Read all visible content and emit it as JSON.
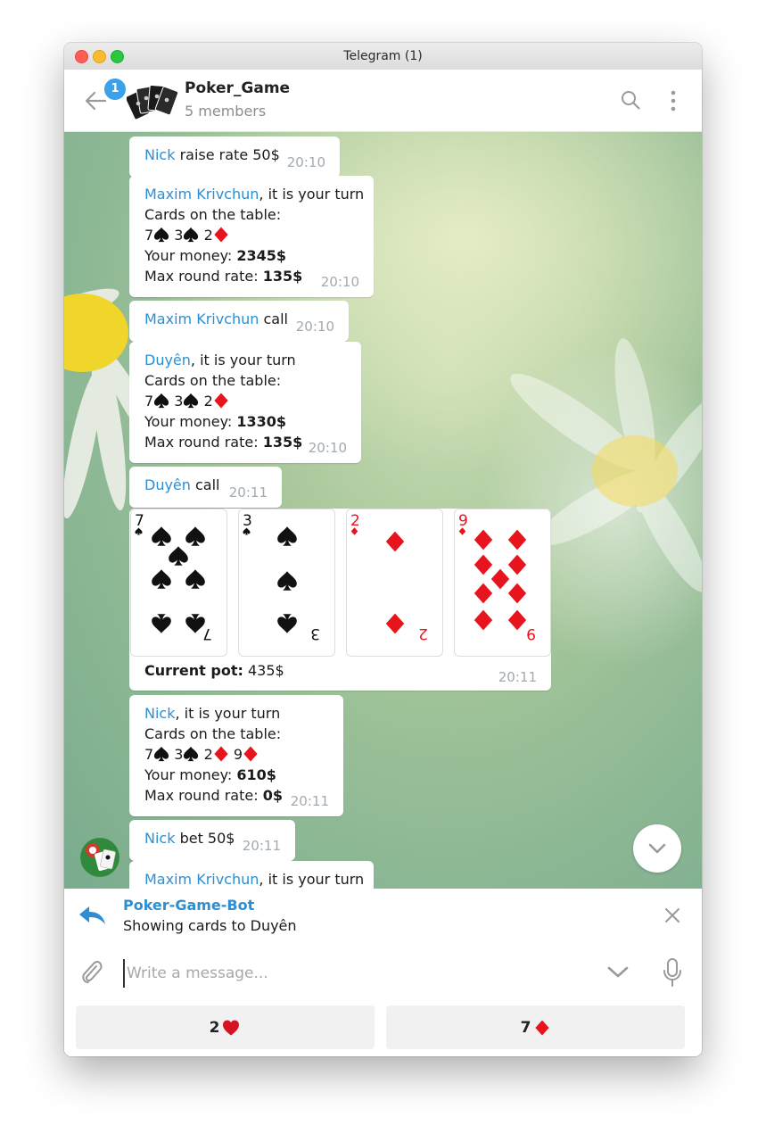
{
  "window": {
    "title": "Telegram (1)"
  },
  "header": {
    "badge": "1",
    "chat_name": "Poker_Game",
    "members": "5 members",
    "icons": [
      "back-arrow-icon",
      "search-icon",
      "more-vertical-icon"
    ]
  },
  "messages": [
    {
      "sender": "Nick",
      "text": " raise rate 50$",
      "time": "20:10"
    },
    {
      "sender": "Maxim Krivchun",
      "text": ", it is your turn",
      "cards_label": "Cards on the table:",
      "cards": [
        "7",
        "3",
        "2"
      ],
      "money_label": "Your money: ",
      "money": "2345$",
      "rate_label": "Max round rate: ",
      "rate": "135$",
      "time": "20:10"
    },
    {
      "sender": "Maxim Krivchun",
      "text": " call",
      "time": "20:10"
    },
    {
      "sender": "Duyên",
      "text": ", it is your turn",
      "cards_label": "Cards on the table:",
      "cards": [
        "7",
        "3",
        "2"
      ],
      "money_label": "Your money: ",
      "money": "1330$",
      "rate_label": "Max round rate: ",
      "rate": "135$",
      "time": "20:10"
    },
    {
      "sender": "Duyên",
      "text": " call",
      "time": "20:11"
    },
    {
      "type": "cards_image",
      "cards": [
        {
          "rank": "7",
          "suit": "spades"
        },
        {
          "rank": "3",
          "suit": "spades"
        },
        {
          "rank": "2",
          "suit": "diamonds"
        },
        {
          "rank": "9",
          "suit": "diamonds"
        }
      ],
      "pot_label": "Current pot:",
      "pot": " 435$",
      "time": "20:11"
    },
    {
      "sender": "Nick",
      "text": ", it is your turn",
      "cards_label": "Cards on the table:",
      "cards": [
        "7",
        "3",
        "2",
        "9"
      ],
      "money_label": "Your money: ",
      "money": "610$",
      "rate_label": "Max round rate: ",
      "rate": "0$",
      "time": "20:11"
    },
    {
      "sender": "Nick",
      "text": " bet 50$",
      "time": "20:11"
    },
    {
      "sender": "Maxim Krivchun",
      "text": ", it is your turn"
    }
  ],
  "reply": {
    "name": "Poker-Game-Bot",
    "text": "Showing cards to Duyên"
  },
  "composer": {
    "placeholder": "Write a message..."
  },
  "keyboard": [
    {
      "label": "2",
      "suit": "hearts"
    },
    {
      "label": "7",
      "suit": "diamonds"
    }
  ],
  "colors": {
    "accent": "#2e8ed1",
    "badge": "#3ba1e8",
    "red_suit": "#e8141d",
    "black_suit": "#111111"
  }
}
